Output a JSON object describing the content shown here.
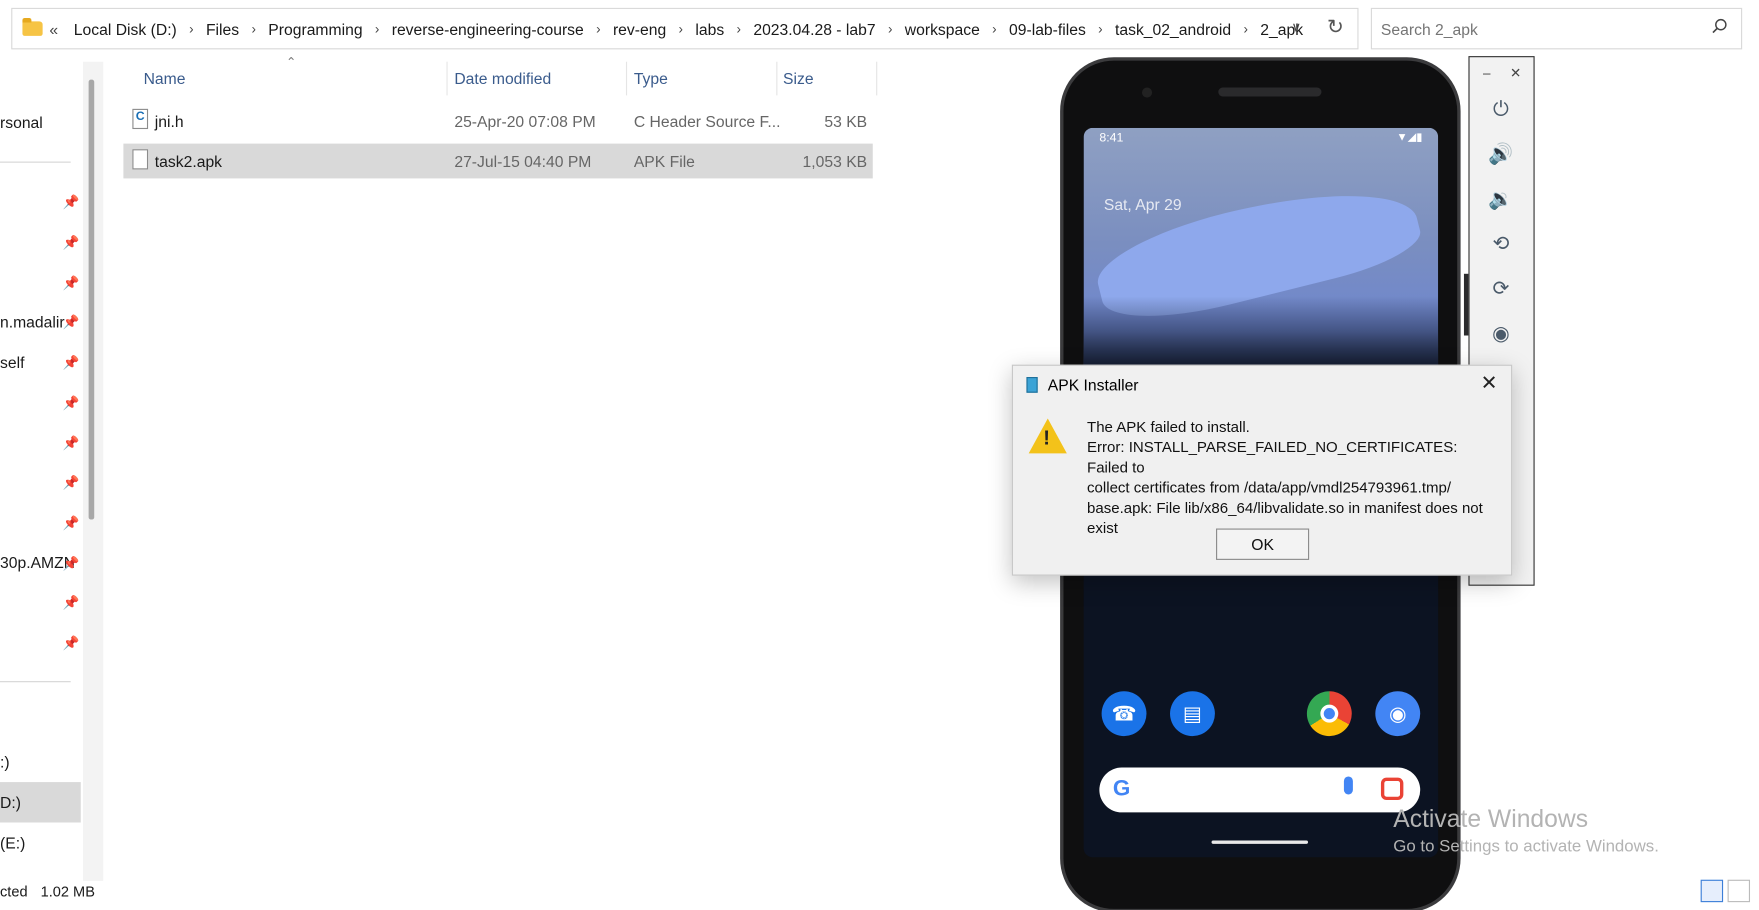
{
  "breadcrumb": {
    "lead": "«",
    "items": [
      "Local Disk (D:)",
      "Files",
      "Programming",
      "reverse-engineering-course",
      "rev-eng",
      "labs",
      "2023.04.28 - lab7",
      "workspace",
      "09-lab-files",
      "task_02_android",
      "2_apk"
    ]
  },
  "search": {
    "placeholder": "Search 2_apk"
  },
  "nav": {
    "items": [
      {
        "label": "rsonal"
      },
      {
        "label": "n.madalir"
      },
      {
        "label": "self"
      },
      {
        "label": "30p.AMZN"
      },
      {
        "label": ":)"
      },
      {
        "label": "D:)"
      },
      {
        "label": "(E:)"
      }
    ]
  },
  "columns": {
    "name": "Name",
    "date": "Date modified",
    "type": "Type",
    "size": "Size"
  },
  "files": [
    {
      "name": "jni.h",
      "date": "25-Apr-20 07:08 PM",
      "type": "C Header Source F...",
      "size": "53 KB"
    },
    {
      "name": "task2.apk",
      "date": "27-Jul-15 04:40 PM",
      "type": "APK File",
      "size": "1,053 KB"
    }
  ],
  "status": {
    "left": "cted",
    "size": "1.02 MB"
  },
  "phone": {
    "time": "8:41",
    "date": "Sat, Apr 29",
    "google_letter": "G"
  },
  "dialog": {
    "title": "APK Installer",
    "message_lines": [
      "The APK failed to install.",
      "Error: INSTALL_PARSE_FAILED_NO_CERTIFICATES: Failed to",
      "collect certificates from /data/app/vmdl254793961.tmp/",
      "base.apk: File lib/x86_64/libvalidate.so in manifest does not",
      "exist"
    ],
    "ok_label": "OK"
  },
  "watermark": {
    "line1": "Activate Windows",
    "line2": "Go to Settings to activate Windows."
  },
  "icons": {
    "power": "power-icon",
    "volume_up": "volume-up-icon",
    "volume_down": "volume-down-icon",
    "rotate_left": "rotate-left-icon",
    "rotate_right": "rotate-right-icon",
    "camera": "camera-icon",
    "warning": "warning-icon"
  },
  "colors": {
    "selection": "#d9d9d9",
    "warning": "#f3c21a",
    "link_header": "#3a5b8c"
  }
}
